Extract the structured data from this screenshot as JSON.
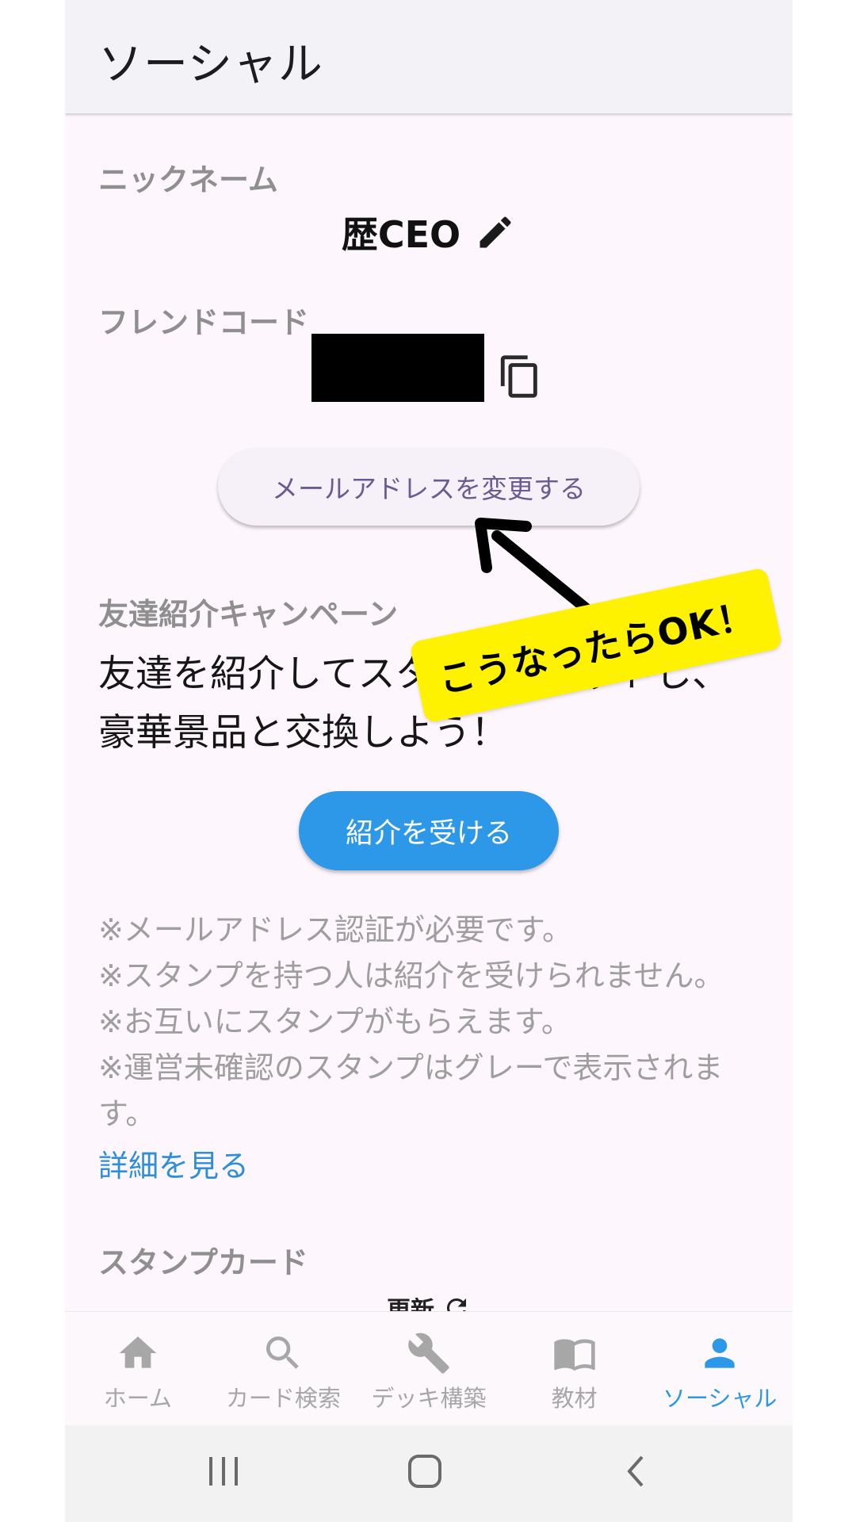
{
  "app_bar": {
    "title": "ソーシャル"
  },
  "nickname": {
    "label": "ニックネーム",
    "value": "歴CEO",
    "edit_icon": "pencil-icon"
  },
  "friend_code": {
    "label": "フレンドコード",
    "copy_icon": "copy-icon"
  },
  "change_email_button": "メールアドレスを変更する",
  "campaign": {
    "label": "友達紹介キャンペーン",
    "text_line1": "友達を紹介してスタンプをゲットし、",
    "text_line2": "豪華景品と交換しよう！",
    "referral_button": "紹介を受ける",
    "notes": [
      "※メールアドレス認証が必要です。",
      "※スタンプを持つ人は紹介を受けられません。",
      "※お互いにスタンプがもらえます。",
      "※運営未確認のスタンプはグレーで表示されます。"
    ],
    "details_link": "詳細を見る"
  },
  "stamp_card": {
    "label": "スタンプカード",
    "refresh_label": "更新",
    "refresh_icon": "refresh-icon"
  },
  "bottom_nav": {
    "items": [
      {
        "label": "ホーム",
        "icon": "home-icon",
        "active": false
      },
      {
        "label": "カード検索",
        "icon": "search-icon",
        "active": false
      },
      {
        "label": "デッキ構築",
        "icon": "wrench-icon",
        "active": false
      },
      {
        "label": "教材",
        "icon": "book-icon",
        "active": false
      },
      {
        "label": "ソーシャル",
        "icon": "person-icon",
        "active": true
      }
    ]
  },
  "annotation": {
    "text": "こうなったらOK！"
  },
  "colors": {
    "accent": "#2d97e8",
    "highlight": "#fff200",
    "button_text": "#6b5b92"
  }
}
